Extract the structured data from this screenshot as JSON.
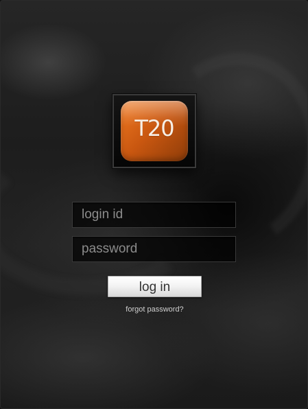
{
  "logo": {
    "text": "T20"
  },
  "login_form": {
    "login_id": {
      "value": "",
      "placeholder": "login id"
    },
    "password": {
      "value": "",
      "placeholder": "password"
    },
    "submit_label": "log in",
    "forgot_password_label": "forgot password?"
  },
  "colors": {
    "background": "#1f1f1f",
    "logo_orange": "#d8641a",
    "field_background": "#090909",
    "button_background": "#f2f2f2",
    "link_text": "#d0d0d0"
  }
}
